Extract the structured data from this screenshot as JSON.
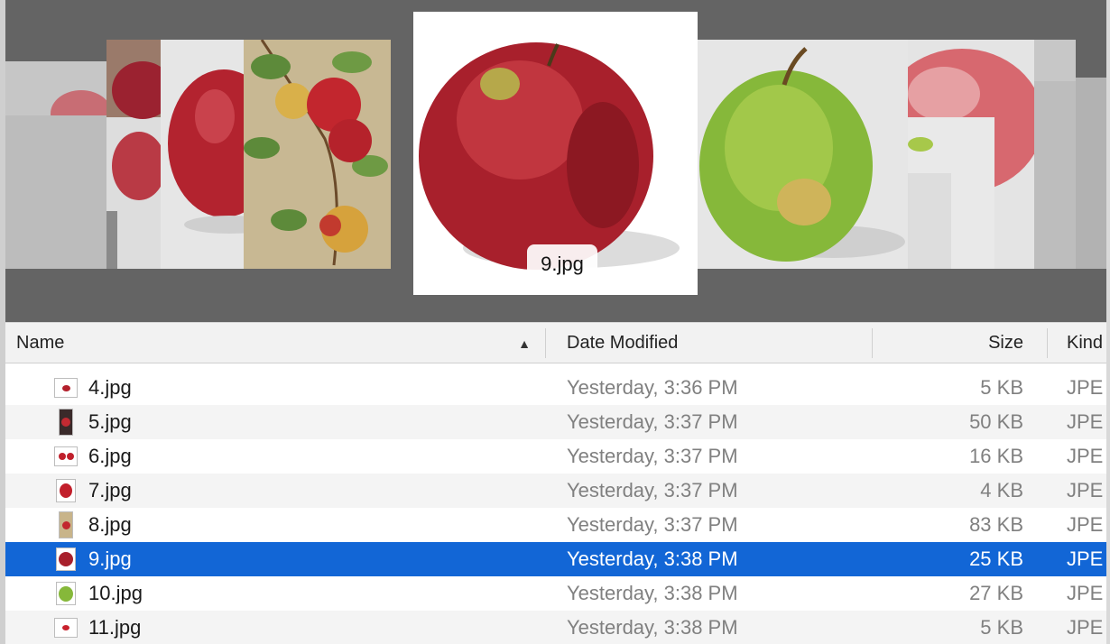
{
  "coverflow": {
    "selected_caption": "9.jpg"
  },
  "columns": {
    "name": "Name",
    "date_modified": "Date Modified",
    "size": "Size",
    "kind": "Kind"
  },
  "files": [
    {
      "name": "4.jpg",
      "date": "Yesterday, 3:36 PM",
      "size": "5 KB",
      "kind": "JPE"
    },
    {
      "name": "5.jpg",
      "date": "Yesterday, 3:37 PM",
      "size": "50 KB",
      "kind": "JPE"
    },
    {
      "name": "6.jpg",
      "date": "Yesterday, 3:37 PM",
      "size": "16 KB",
      "kind": "JPE"
    },
    {
      "name": "7.jpg",
      "date": "Yesterday, 3:37 PM",
      "size": "4 KB",
      "kind": "JPE"
    },
    {
      "name": "8.jpg",
      "date": "Yesterday, 3:37 PM",
      "size": "83 KB",
      "kind": "JPE"
    },
    {
      "name": "9.jpg",
      "date": "Yesterday, 3:38 PM",
      "size": "25 KB",
      "kind": "JPE"
    },
    {
      "name": "10.jpg",
      "date": "Yesterday, 3:38 PM",
      "size": "27 KB",
      "kind": "JPE"
    },
    {
      "name": "11.jpg",
      "date": "Yesterday, 3:38 PM",
      "size": "5 KB",
      "kind": "JPE"
    }
  ],
  "colors": {
    "selection": "#1266d6",
    "coverflow_background": "#646464",
    "apple_red": "#b3202c",
    "apple_green": "#86b83a"
  }
}
